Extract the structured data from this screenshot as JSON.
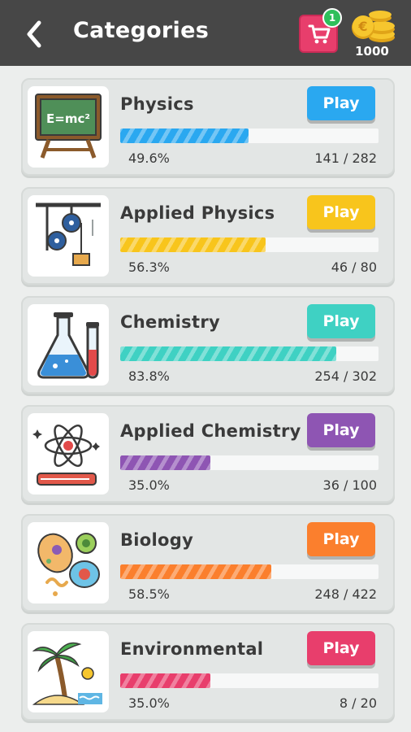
{
  "header": {
    "title": "Categories",
    "cart_badge": "1",
    "coins": "1000",
    "back_icon": "arrow-left-icon",
    "cart_icon": "shopping-cart-icon",
    "coin_icon": "coin-stack-icon"
  },
  "play_label": "Play",
  "categories": [
    {
      "name": "Physics",
      "percent": "49.6%",
      "progress": 0.496,
      "count": "141 / 282",
      "color": "#2aa8f0",
      "icon": "blackboard-formula-icon"
    },
    {
      "name": "Applied Physics",
      "percent": "56.3%",
      "progress": 0.563,
      "count": "46 / 80",
      "color": "#f8c51c",
      "icon": "pulley-icon"
    },
    {
      "name": "Chemistry",
      "percent": "83.8%",
      "progress": 0.838,
      "count": "254 / 302",
      "color": "#3fd1c3",
      "icon": "chemistry-flask-icon"
    },
    {
      "name": "Applied Chemistry",
      "percent": "35.0%",
      "progress": 0.35,
      "count": "36 / 100",
      "color": "#8e55b3",
      "icon": "atom-book-icon"
    },
    {
      "name": "Biology",
      "percent": "58.5%",
      "progress": 0.585,
      "count": "248 / 422",
      "color": "#fb7f2d",
      "icon": "cells-icon"
    },
    {
      "name": "Environmental",
      "percent": "35.0%",
      "progress": 0.35,
      "count": "8 / 20",
      "color": "#e83e6c",
      "icon": "palm-island-icon"
    }
  ]
}
